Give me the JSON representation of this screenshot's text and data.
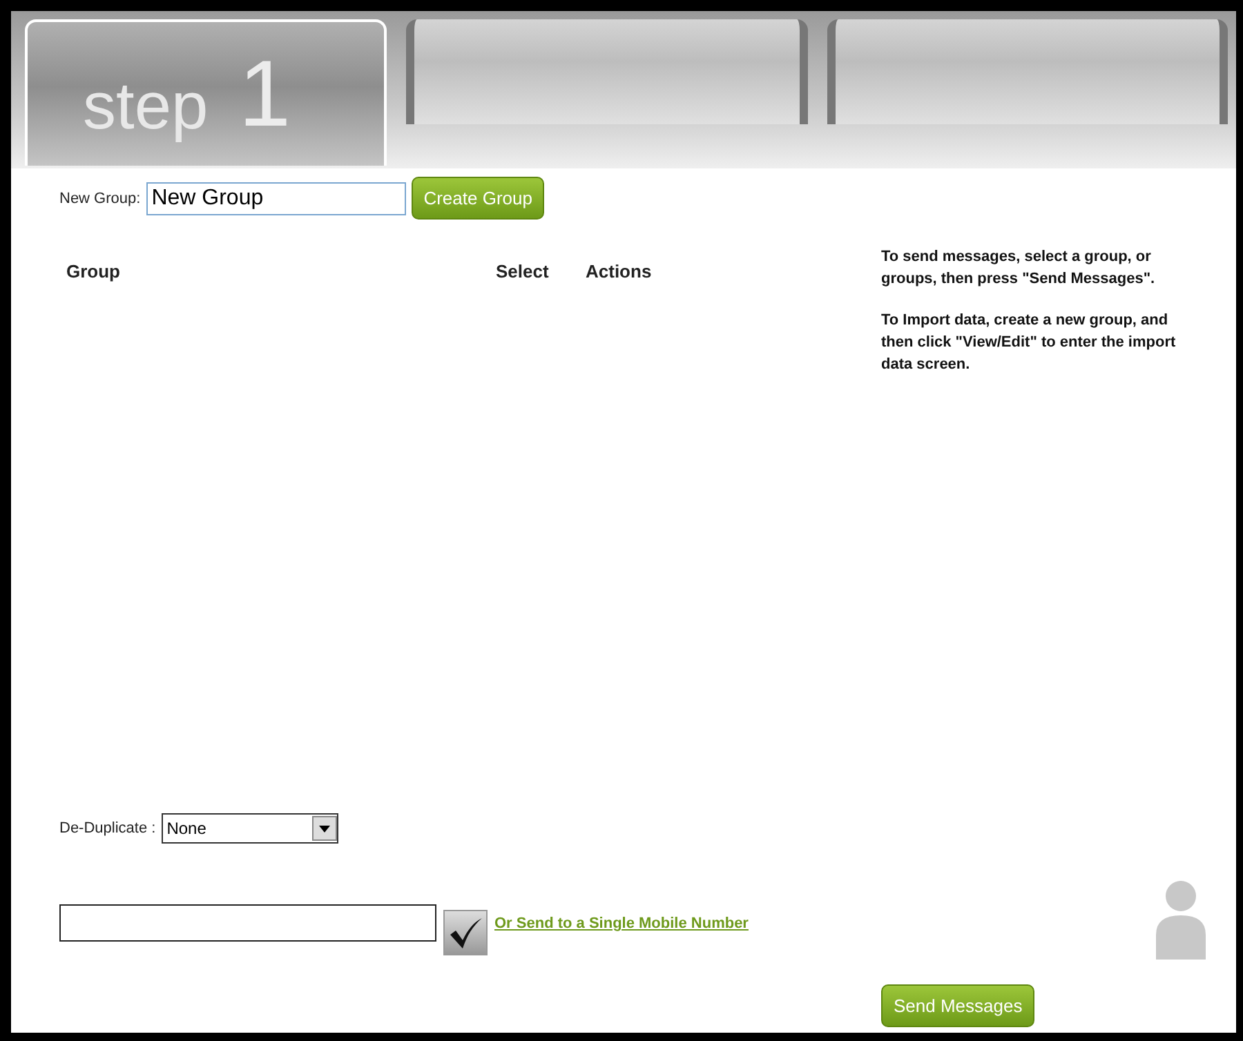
{
  "step_tabs": [
    {
      "label": "step",
      "number": "1",
      "selected": true
    },
    {
      "selected": false
    },
    {
      "selected": false
    }
  ],
  "new_group": {
    "label": "New Group:",
    "value": "New Group",
    "button": "Create Group"
  },
  "table": {
    "columns": [
      "Group",
      "Select",
      "Actions"
    ]
  },
  "help": [
    "To send messages, select a group, or groups, then press \"Send Messages\".",
    "To Import data, create a new group, and then click \"View/Edit\" to enter the import data screen."
  ],
  "dedup": {
    "label": "De-Duplicate :",
    "value": "None"
  },
  "single_number": {
    "link": "Or Send to a Single Mobile Number"
  },
  "send_button": "Send Messages"
}
